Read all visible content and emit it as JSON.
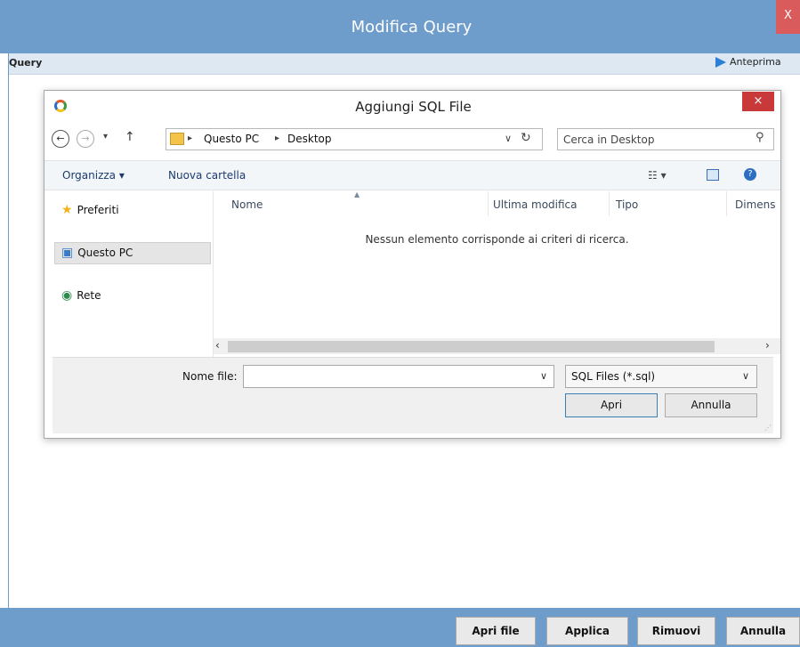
{
  "outer": {
    "title": "Modifica Query",
    "close_label": "X",
    "query_label": "Query",
    "preview_label": "Anteprima",
    "buttons": [
      "Apri file",
      "Applica",
      "Rimuovi",
      "Annulla"
    ]
  },
  "dialog": {
    "title": "Aggiungi SQL File",
    "close_label": "×",
    "nav": {
      "back": "←",
      "forward": "→",
      "recent": "▾",
      "up": "↑"
    },
    "address": {
      "items": [
        "Questo PC",
        "Desktop"
      ],
      "separator": "▸"
    },
    "search": {
      "placeholder": "Cerca in Desktop"
    },
    "toolbar": {
      "organize": "Organizza ▾",
      "new_folder": "Nuova cartella"
    },
    "sidebar": {
      "favorites": "Preferiti",
      "this_pc": "Questo PC",
      "network": "Rete"
    },
    "columns": [
      "Nome",
      "Ultima modifica",
      "Tipo",
      "Dimens"
    ],
    "empty_message": "Nessun elemento corrisponde ai criteri di ricerca.",
    "filename_label": "Nome file:",
    "filename_value": "",
    "filetype": "SQL Files (*.sql)",
    "open_button": "Apri",
    "cancel_button": "Annulla"
  },
  "colors": {
    "title_blue": "#6e9ccb",
    "close_red": "#c9393a",
    "accent_blue": "#2b7fd6"
  }
}
